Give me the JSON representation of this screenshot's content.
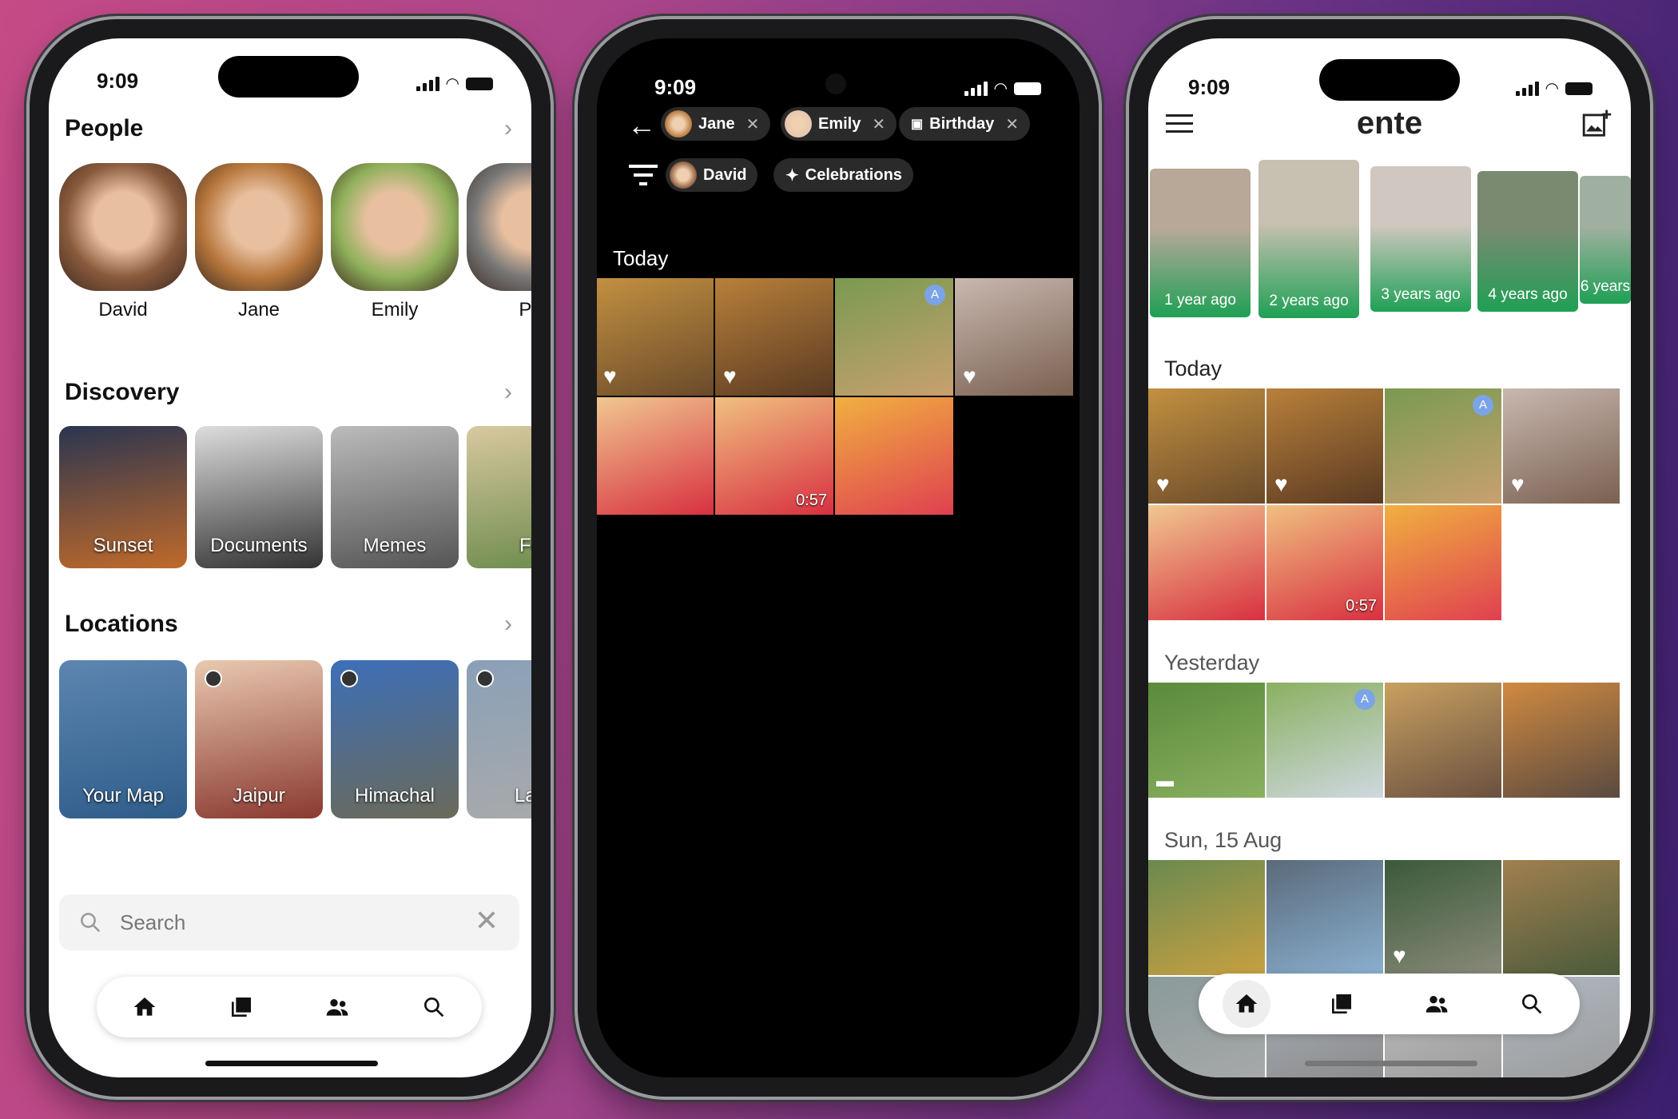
{
  "status": {
    "time": "9:09"
  },
  "left": {
    "people": {
      "title": "People",
      "items": [
        {
          "name": "David",
          "tone": "#8a5a3c"
        },
        {
          "name": "Jane",
          "tone": "#b7773c"
        },
        {
          "name": "Emily",
          "tone": "#8fb05a"
        },
        {
          "name": "Pa",
          "tone": "#777"
        }
      ]
    },
    "discovery": {
      "title": "Discovery",
      "items": [
        {
          "label": "Sunset",
          "tone": "#2b3550",
          "tone2": "#c06a2a"
        },
        {
          "label": "Documents",
          "tone": "#ddd",
          "tone2": "#333"
        },
        {
          "label": "Memes",
          "tone": "#bbb",
          "tone2": "#555"
        },
        {
          "label": "Fo",
          "tone": "#d8c8a0",
          "tone2": "#6a8a4a"
        }
      ]
    },
    "locations": {
      "title": "Locations",
      "items": [
        {
          "label": "Your Map",
          "tone": "#5c86b0",
          "tone2": "#2f5d8a",
          "pin": false
        },
        {
          "label": "Jaipur",
          "tone": "#e9c8b0",
          "tone2": "#8a3a30",
          "pin": true
        },
        {
          "label": "Himachal",
          "tone": "#3d6fb8",
          "tone2": "#6a6a5a",
          "pin": true
        },
        {
          "label": "Lad",
          "tone": "#8aa0b8",
          "tone2": "#aaa",
          "pin": true
        }
      ]
    },
    "search": {
      "placeholder": "Search"
    },
    "nav": [
      "home",
      "photos",
      "people",
      "search"
    ]
  },
  "middle": {
    "chips_row1": [
      {
        "label": "Jane",
        "type": "person",
        "tone": "#b7773c"
      },
      {
        "label": "Emily",
        "type": "person",
        "tone": "#e6c6b0"
      },
      {
        "label": "Birthday",
        "type": "album"
      }
    ],
    "chips_row2": [
      {
        "label": "David",
        "type": "person",
        "tone": "#8a5a3c"
      },
      {
        "label": "Celebrations",
        "type": "magic"
      }
    ],
    "section": "Today",
    "photos": [
      {
        "tone": "#c29040",
        "tone2": "#6a4a2a",
        "heart": true
      },
      {
        "tone": "#b8803a",
        "tone2": "#5a3a22",
        "heart": true
      },
      {
        "tone": "#7a9a50",
        "tone2": "#c8a070",
        "badge": "A"
      },
      {
        "tone": "#c8b8b0",
        "tone2": "#7a6050",
        "heart": true
      },
      {
        "tone": "#f0c890",
        "tone2": "#d83040"
      },
      {
        "tone": "#f0c080",
        "tone2": "#d83040",
        "duration": "0:57"
      },
      {
        "tone": "#f0b040",
        "tone2": "#e04050"
      }
    ]
  },
  "right": {
    "title": "ente",
    "memories": [
      {
        "label": "1 year ago",
        "tone": "#b8a898"
      },
      {
        "label": "2 years ago",
        "tone": "#c8c0b0"
      },
      {
        "label": "3 years ago",
        "tone": "#d0c8c0"
      },
      {
        "label": "4 years ago",
        "tone": "#7a8a70"
      },
      {
        "label": "6 years",
        "tone": "#a0b0a0"
      }
    ],
    "sections": [
      {
        "title": "Today",
        "photos": [
          {
            "tone": "#c29040",
            "tone2": "#6a4a2a",
            "heart": true
          },
          {
            "tone": "#b8803a",
            "tone2": "#5a3a22",
            "heart": true
          },
          {
            "tone": "#7a9a50",
            "tone2": "#c8a070",
            "badge": "A"
          },
          {
            "tone": "#c8b8b0",
            "tone2": "#7a6050",
            "heart": true
          },
          {
            "tone": "#f0c890",
            "tone2": "#d83040"
          },
          {
            "tone": "#f0c080",
            "tone2": "#d83040",
            "duration": "0:57"
          },
          {
            "tone": "#f0b040",
            "tone2": "#e04050"
          }
        ]
      },
      {
        "title": "Yesterday",
        "photos": [
          {
            "tone": "#5a8a3a",
            "tone2": "#8ab060",
            "comment": true
          },
          {
            "tone": "#8ab060",
            "tone2": "#cfd8e0",
            "badge": "A"
          },
          {
            "tone": "#c8a060",
            "tone2": "#6a5040"
          },
          {
            "tone": "#d08a40",
            "tone2": "#5a4a40"
          }
        ]
      },
      {
        "title": "Sun, 15 Aug",
        "photos": [
          {
            "tone": "#6a8a50",
            "tone2": "#c8a040"
          },
          {
            "tone": "#5a6a7a",
            "tone2": "#8ab0d0"
          },
          {
            "tone": "#3a5a3a",
            "tone2": "#8a8a7a",
            "heart": true
          },
          {
            "tone": "#a08050",
            "tone2": "#4a5a3a"
          },
          {
            "tone": "#8a9a9a",
            "tone2": "#aaa"
          },
          {
            "tone": "#aab0b8",
            "tone2": "#888"
          },
          {
            "tone": "#c0c0c0",
            "tone2": "#999"
          },
          {
            "tone": "#b0b8c0",
            "tone2": "#999"
          }
        ]
      }
    ],
    "nav": [
      "home",
      "photos",
      "people",
      "search"
    ]
  }
}
